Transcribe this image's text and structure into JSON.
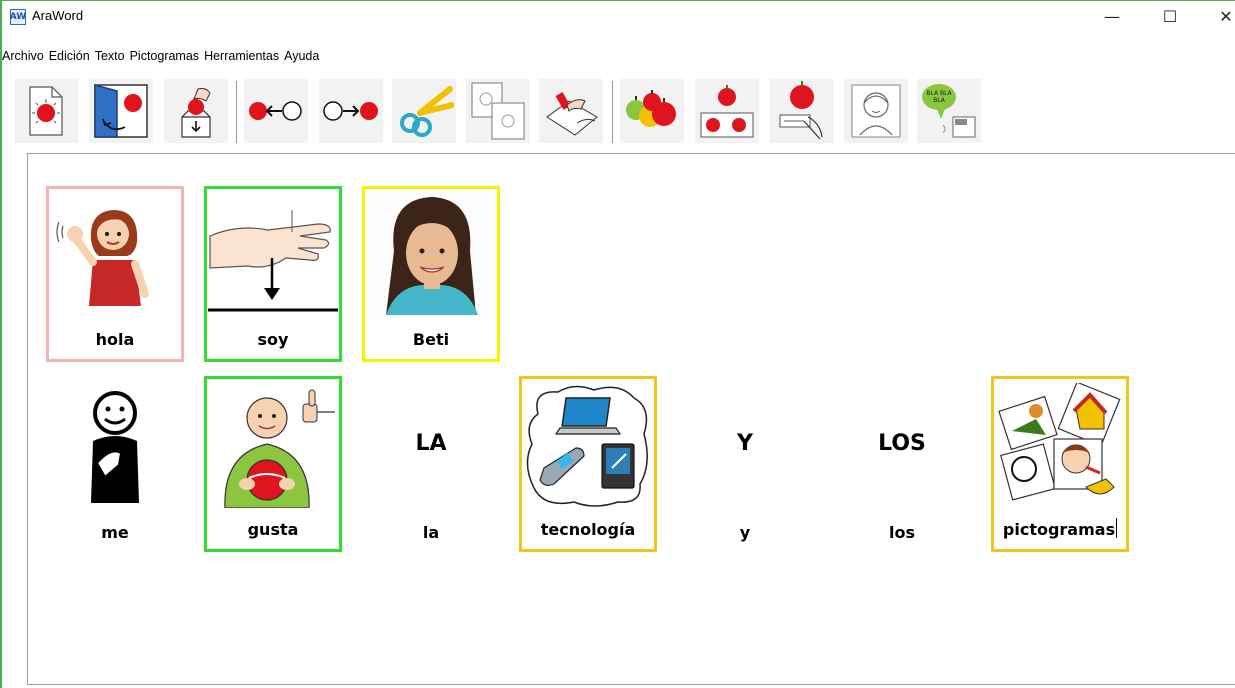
{
  "window": {
    "title": "AraWord",
    "icon_label": "AW",
    "controls": {
      "minimize": "—",
      "maximize": "☐",
      "close": "✕"
    }
  },
  "menu": [
    "Archivo",
    "Edición",
    "Texto",
    "Pictogramas",
    "Herramientas",
    "Ayuda"
  ],
  "toolbar": [
    {
      "name": "new-document-icon"
    },
    {
      "name": "open-document-icon"
    },
    {
      "name": "save-document-icon"
    },
    {
      "name": "move-left-icon"
    },
    {
      "name": "move-right-icon"
    },
    {
      "name": "cut-icon"
    },
    {
      "name": "copy-icon"
    },
    {
      "name": "paste-icon"
    },
    {
      "name": "change-pictogram-icon"
    },
    {
      "name": "pictogram-settings-icon"
    },
    {
      "name": "edit-pictogram-icon"
    },
    {
      "name": "add-own-image-icon"
    },
    {
      "name": "text-to-speech-icon"
    }
  ],
  "colors": {
    "window_border": "#4caf50",
    "pink_border": "#f4b4b4",
    "green_border": "#33dd33",
    "yellow_border": "#f5f500",
    "orange_border": "#f5c518"
  },
  "row1": [
    {
      "word": "hola",
      "border": "#f4b4b4",
      "icon": "girl-waving-icon"
    },
    {
      "word": "soy",
      "border": "#33dd33",
      "icon": "hand-pointing-down-icon"
    },
    {
      "word": "Beti",
      "border": "#f5f500",
      "icon": "woman-photo-icon"
    }
  ],
  "row2": [
    {
      "word": "me",
      "pic_text": "",
      "border": "",
      "icon": "self-pointing-person-icon"
    },
    {
      "word": "gusta",
      "pic_text": "",
      "border": "#33dd33",
      "icon": "boy-likes-ball-icon"
    },
    {
      "word": "la",
      "pic_text": "LA",
      "border": "",
      "icon": ""
    },
    {
      "word": "tecnología",
      "pic_text": "",
      "border": "#f5c518",
      "icon": "technology-devices-icon"
    },
    {
      "word": "y",
      "pic_text": "Y",
      "border": "",
      "icon": ""
    },
    {
      "word": "los",
      "pic_text": "LOS",
      "border": "",
      "icon": ""
    },
    {
      "word": "pictogramas",
      "pic_text": "",
      "border": "#f5c518",
      "icon": "pictograms-collage-icon"
    }
  ]
}
